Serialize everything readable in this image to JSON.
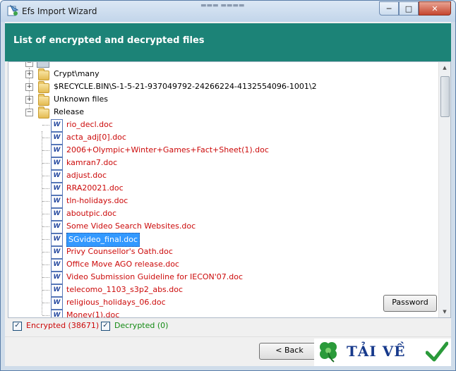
{
  "window": {
    "title": "Efs Import Wizard"
  },
  "caption_buttons": {
    "minimize": "─",
    "maximize": "□",
    "close": "✕"
  },
  "header": {
    "title": "List of encrypted and decrypted files"
  },
  "tree": {
    "folders": [
      {
        "label": "Crypt\\many",
        "expander": "+"
      },
      {
        "label": "$RECYCLE.BIN\\S-1-5-21-937049792-24266224-4132554096-1001\\2",
        "expander": "+"
      },
      {
        "label": "Unknown files",
        "expander": "+"
      },
      {
        "label": "Release",
        "expander": "−"
      }
    ],
    "files": [
      "rio_decl.doc",
      "acta_adj[0].doc",
      "2006+Olympic+Winter+Games+Fact+Sheet(1).doc",
      "kamran7.doc",
      "adjust.doc",
      "RRA20021.doc",
      "tln-holidays.doc",
      "aboutpic.doc",
      "Some Video Search Websites.doc",
      "SGvideo_final.doc",
      "Privy Counsellor's Oath.doc",
      "Office Move AGO release.doc",
      "Video Submission Guideline for IECON'07.doc",
      "telecomo_1103_s3p2_abs.doc",
      "religious_holidays_06.doc",
      "Money(1).doc"
    ],
    "selected_file": "SGvideo_final.doc",
    "doc_icon_glyph": "W"
  },
  "buttons": {
    "password": "Password",
    "back": "< Back"
  },
  "filters": {
    "encrypted": {
      "label": "Encrypted (38671)",
      "checked": true,
      "mark": "✓"
    },
    "decrypted": {
      "label": "Decrypted (0)",
      "checked": true,
      "mark": "✓"
    }
  },
  "watermark": {
    "text": "TẢI VỀ"
  },
  "colors": {
    "header": "#1c8377",
    "encrypted_text": "#cc0a0a",
    "decrypted_text": "#138a13",
    "selection": "#3399ff"
  }
}
